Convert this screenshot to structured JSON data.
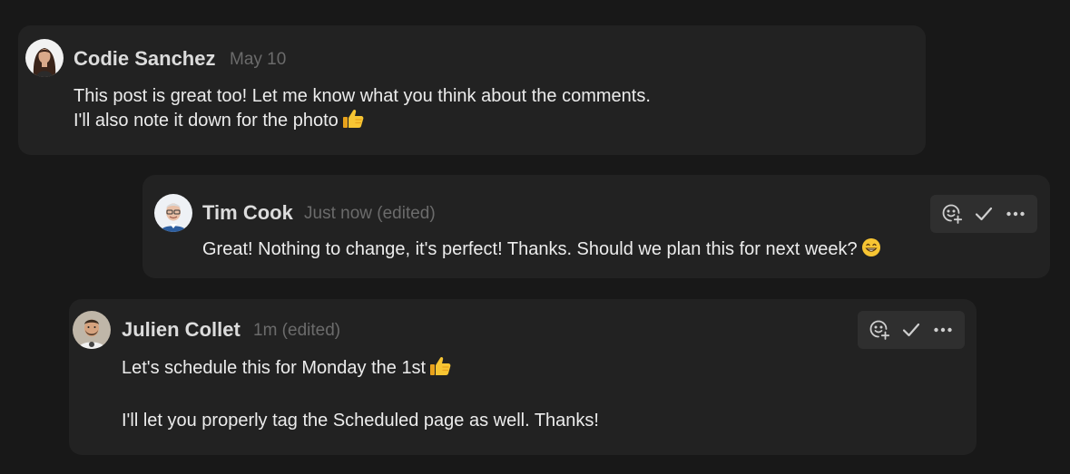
{
  "comments": [
    {
      "author": "Codie Sanchez",
      "time": "May 10",
      "lines": [
        "This post is great too! Let me know what you think about the comments.",
        "I'll also note it down for the photo"
      ],
      "emoji": "thumbs-up"
    },
    {
      "author": "Tim Cook",
      "time": "Just now (edited)",
      "lines": [
        "Great! Nothing to change, it's perfect! Thanks. Should we plan this for next week?"
      ],
      "emoji": "grinning-face",
      "actions": [
        "add-reaction-icon",
        "resolve-check-icon",
        "more-options-icon"
      ]
    },
    {
      "author": "Julien Collet",
      "time": "1m (edited)",
      "lines": [
        "Let's schedule this for Monday the 1st",
        "I'll let you properly tag the Scheduled page as well. Thanks!"
      ],
      "emoji": "thumbs-up",
      "actions": [
        "add-reaction-icon",
        "resolve-check-icon",
        "more-options-icon"
      ]
    }
  ],
  "colors": {
    "background": "#181818",
    "card": "#222222",
    "name": "#dcdcdc",
    "meta": "#6b6b6b",
    "text": "#ececec",
    "action_bar": "#2f2f2f"
  }
}
